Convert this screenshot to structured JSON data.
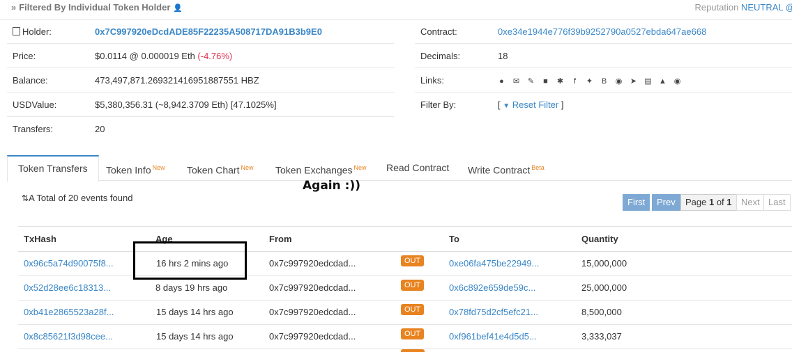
{
  "header": {
    "title": "Filtered By Individual Token Holder",
    "reputation_label": "Reputation",
    "reputation_value": "NEUTRAL"
  },
  "holder_info": {
    "holder_label": "Holder:",
    "holder_value": "0x7C997920eDcdADE85F22235A508717DA91B3b9E0",
    "price_label": "Price:",
    "price_value": "$0.0114 @ 0.000019 Eth ",
    "price_change": "(-4.76%)",
    "balance_label": "Balance:",
    "balance_value": "473,497,871.269321416951887551 HBZ",
    "usd_label": "USDValue:",
    "usd_value": "$5,380,356.31 (~8,942.3709 Eth) [47.1025%]",
    "transfers_label": "Transfers:",
    "transfers_value": "20"
  },
  "contract_info": {
    "contract_label": "Contract:",
    "contract_value": "0xe34e1944e776f39b9252790a0527ebda647ae668",
    "decimals_label": "Decimals:",
    "decimals_value": "18",
    "links_label": "Links:",
    "filter_label": "Filter By:",
    "reset_filter": "Reset Filter",
    "filter_open": "[",
    "filter_close": "]"
  },
  "tabs": [
    {
      "label": "Token Transfers",
      "sup": ""
    },
    {
      "label": "Token Info",
      "sup": "New"
    },
    {
      "label": "Token Chart",
      "sup": "New"
    },
    {
      "label": "Token Exchanges",
      "sup": "New"
    },
    {
      "label": "Read Contract",
      "sup": ""
    },
    {
      "label": "Write Contract",
      "sup": "Beta"
    }
  ],
  "annotation": "Again :))",
  "summary": "A Total of 20 events found",
  "pager": {
    "first": "First",
    "prev": "Prev",
    "page_prefix": "Page ",
    "page_num": "1",
    "page_of": " of ",
    "page_total": "1",
    "next": "Next",
    "last": "Last"
  },
  "table": {
    "headers": [
      "TxHash",
      "Age",
      "From",
      "To",
      "Quantity"
    ],
    "rows": [
      {
        "hash": "0x96c5a74d90075f8...",
        "age": "16 hrs 2 mins ago",
        "from": "0x7c997920edcdad...",
        "dir": "OUT",
        "to": "0xe06fa475be22949...",
        "qty": "15,000,000"
      },
      {
        "hash": "0x52d28ee6c18313...",
        "age": "8 days 19 hrs ago",
        "from": "0x7c997920edcdad...",
        "dir": "OUT",
        "to": "0x6c892e659de59c...",
        "qty": "25,000,000"
      },
      {
        "hash": "0xb41e2865523a28f...",
        "age": "15 days 14 hrs ago",
        "from": "0x7c997920edcdad...",
        "dir": "OUT",
        "to": "0x78fd75d2cf5efc21...",
        "qty": "8,500,000"
      },
      {
        "hash": "0x8c85621f3d98cee...",
        "age": "15 days 14 hrs ago",
        "from": "0x7c997920edcdad...",
        "dir": "OUT",
        "to": "0xf961bef41e4d5d5...",
        "qty": "3,333,037"
      }
    ]
  },
  "colors": {
    "link": "#3a87c8",
    "negative": "#e0334f",
    "badge": "#e8831f",
    "pager_active": "#7ea9d4"
  }
}
